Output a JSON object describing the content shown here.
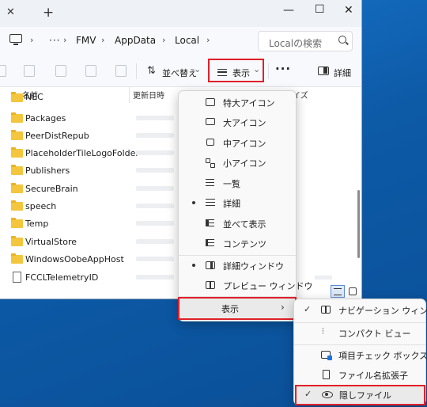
{
  "window": {
    "tab_close": "✕",
    "tab_new": "+",
    "minimize": "—",
    "maximize": "☐",
    "close": "✕"
  },
  "address": {
    "more": "···",
    "crumbs": [
      "FMV",
      "AppData",
      "Local"
    ],
    "chevron": "›",
    "search_placeholder": "Localの検索"
  },
  "toolbar": {
    "sort_label": "並べ替え",
    "sort_arrow": "⌄",
    "view_label": "表示",
    "view_arrow": "⌄",
    "more": "···",
    "details_label": "詳細"
  },
  "columns": {
    "name": "名前",
    "date": "更新日時",
    "size": "イズ"
  },
  "files": [
    {
      "name": "NEC",
      "type": "folder"
    },
    {
      "name": "Packages",
      "type": "folder"
    },
    {
      "name": "PeerDistRepub",
      "type": "folder"
    },
    {
      "name": "PlaceholderTileLogoFolder",
      "type": "folder"
    },
    {
      "name": "Publishers",
      "type": "folder"
    },
    {
      "name": "SecureBrain",
      "type": "folder"
    },
    {
      "name": "speech",
      "type": "folder"
    },
    {
      "name": "Temp",
      "type": "folder"
    },
    {
      "name": "VirtualStore",
      "type": "folder"
    },
    {
      "name": "WindowsOobeAppHost",
      "type": "folder"
    },
    {
      "name": "FCCLTelemetryID",
      "type": "file"
    }
  ],
  "view_menu": {
    "items": [
      {
        "label": "特大アイコン",
        "icon": "box-icon-xl"
      },
      {
        "label": "大アイコン",
        "icon": "box-icon-l"
      },
      {
        "label": "中アイコン",
        "icon": "box-icon-m"
      },
      {
        "label": "小アイコン",
        "icon": "grid-icon"
      },
      {
        "label": "一覧",
        "icon": "list-icon"
      },
      {
        "label": "詳細",
        "icon": "details-lines-icon",
        "selected": true
      },
      {
        "label": "並べて表示",
        "icon": "tiles-icon"
      },
      {
        "label": "コンテンツ",
        "icon": "content-icon"
      },
      {
        "label": "詳細ウィンドウ",
        "icon": "details-pane-icon",
        "selected": true
      },
      {
        "label": "プレビュー ウィンドウ",
        "icon": "preview-pane-icon"
      }
    ],
    "show_label": "表示",
    "show_arrow": "›"
  },
  "show_submenu": {
    "items": [
      {
        "label": "ナビゲーション ウィンドウ",
        "checked": true,
        "icon": "navigation-pane-icon"
      },
      {
        "label": "コンパクト ビュー",
        "checked": false,
        "icon": "compact-view-icon"
      },
      {
        "label": "項目チェック ボックス",
        "checked": false,
        "icon": "item-checkbox-icon"
      },
      {
        "label": "ファイル名拡張子",
        "checked": false,
        "icon": "file-extension-icon"
      },
      {
        "label": "隠しファイル",
        "checked": true,
        "icon": "eye-icon"
      }
    ],
    "check_mark": "✓",
    "compact_glyph": "⫶"
  },
  "colors": {
    "highlight_border": "#e0202a",
    "desktop": "#0d5aa7",
    "folder": "#f4c63d"
  }
}
